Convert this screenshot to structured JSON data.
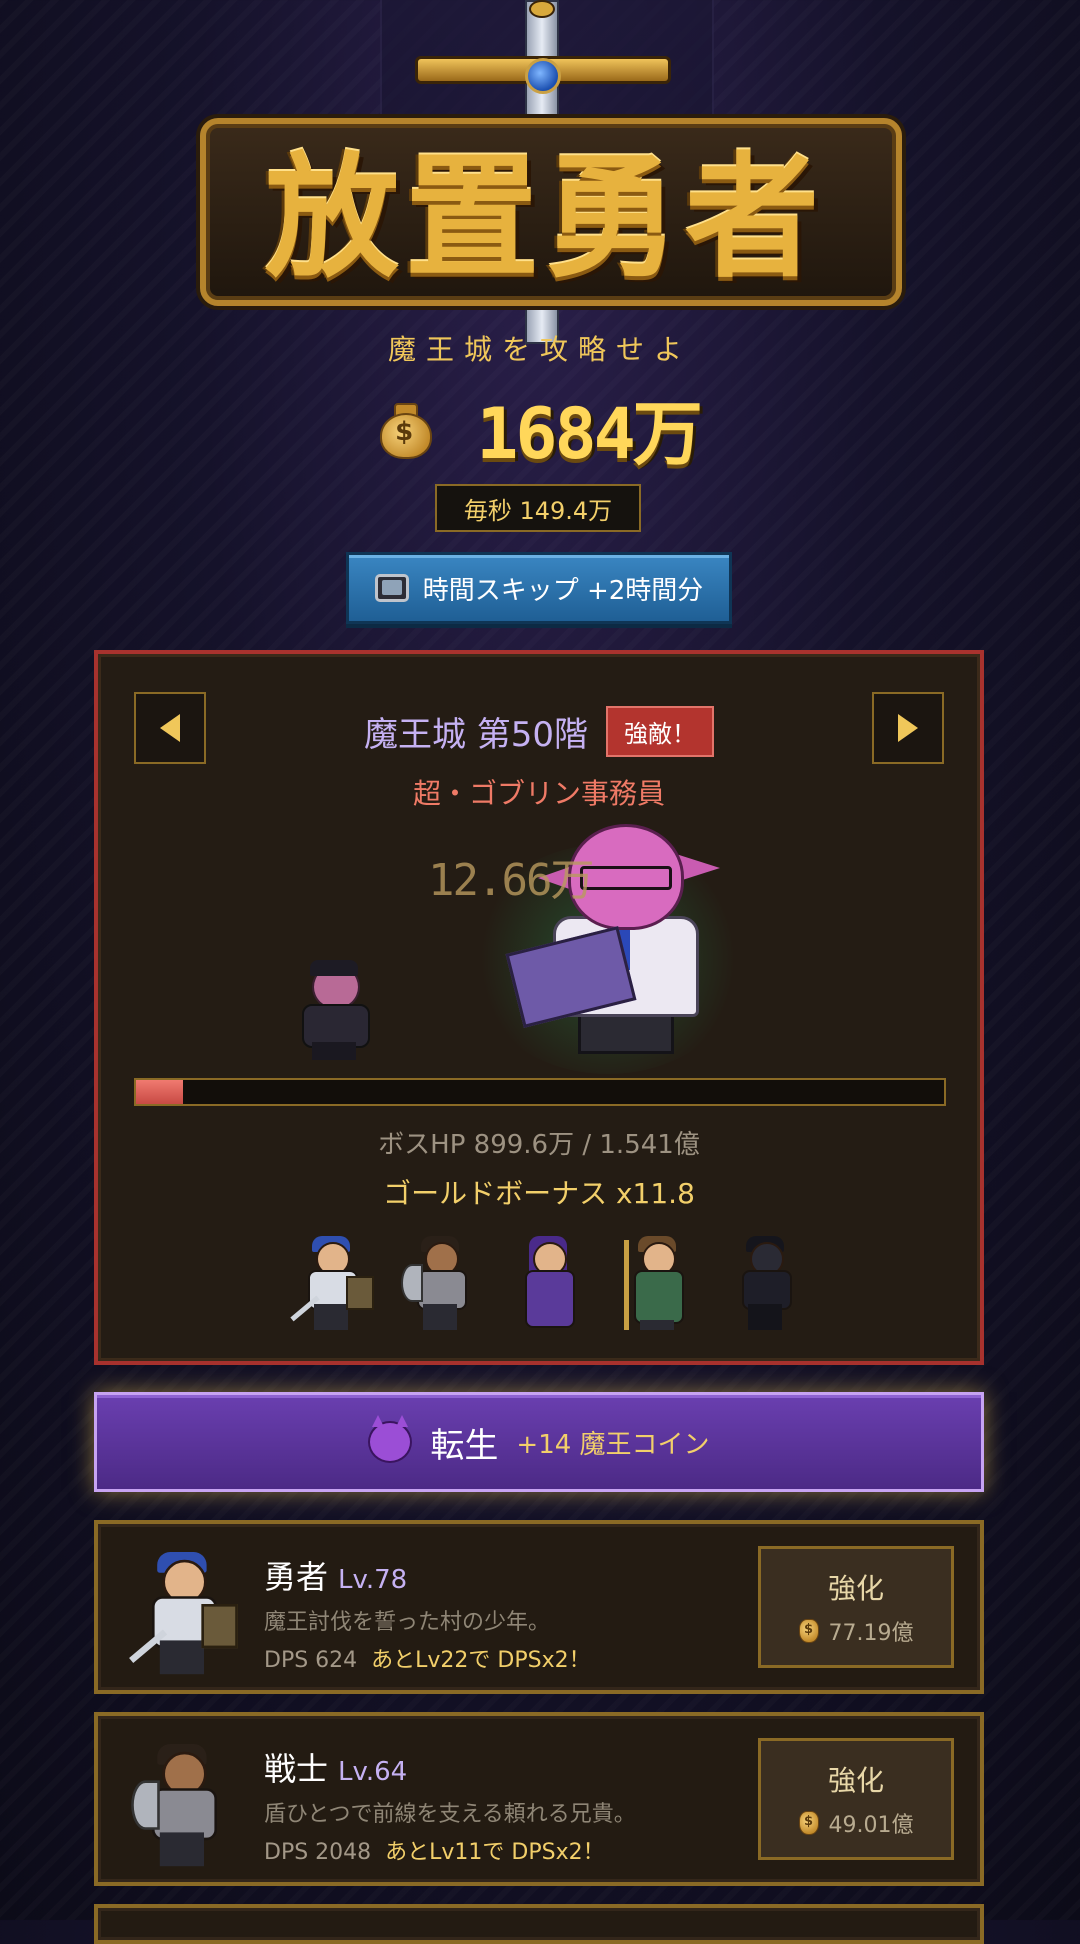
{
  "logo": {
    "title": "放置勇者",
    "subtitle": "魔王城を攻略せよ"
  },
  "gold": {
    "icon": "money-bag-icon",
    "amount": "1684万",
    "per_second": "毎秒 149.4万"
  },
  "skip_button": {
    "icon": "tv-icon",
    "label": "時間スキップ +2時間分"
  },
  "boss": {
    "floor_title": "魔王城 第50階",
    "badge": "強敵！",
    "name": "超・ゴブリン事務員",
    "damage_popup": "12.66万",
    "hp_fraction": 0.058,
    "hp_text": "ボスHP 899.6万 / 1.541億",
    "gold_bonus": "ゴールドボーナス x11.8",
    "prev_icon": "left-arrow-icon",
    "next_icon": "right-arrow-icon",
    "party": [
      "勇者",
      "戦士",
      "魔法使い",
      "僧侶",
      "忍者"
    ]
  },
  "rebirth": {
    "icon": "devil-face-icon",
    "label": "転生",
    "reward": "+14 魔王コイン"
  },
  "heroes": [
    {
      "name": "勇者",
      "level": "Lv.78",
      "desc": "魔王討伐を誓った村の少年。",
      "dps": "DPS 624",
      "next": "あとLv22で DPSx2！",
      "upgrade_label": "強化",
      "cost": "77.19億"
    },
    {
      "name": "戦士",
      "level": "Lv.64",
      "desc": "盾ひとつで前線を支える頼れる兄貴。",
      "dps": "DPS 2048",
      "next": "あとLv11で DPSx2！",
      "upgrade_label": "強化",
      "cost": "49.01億"
    }
  ],
  "colors": {
    "gold": "#f2cf6a",
    "boss_border": "#a8322e",
    "rebirth": "#5a339a",
    "hp_fill": "#e0625a"
  }
}
